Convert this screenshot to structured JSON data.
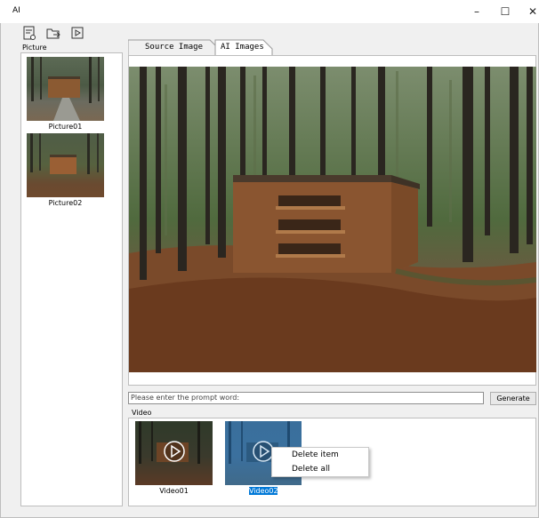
{
  "app": {
    "title": "AI"
  },
  "window_controls": {
    "minimize": "–",
    "maximize": "☐",
    "close": "✕"
  },
  "toolbar": {
    "icons": [
      "document-icon",
      "folder-arrow-icon",
      "play-icon"
    ]
  },
  "sidebar": {
    "title": "Picture",
    "items": [
      {
        "label": "Picture01"
      },
      {
        "label": "Picture02"
      }
    ]
  },
  "tabs": [
    {
      "label": "Source Image"
    },
    {
      "label": "AI Images"
    }
  ],
  "prompt": {
    "placeholder": "Please enter the prompt word:",
    "value": ""
  },
  "generate_button": {
    "label": "Generate"
  },
  "video_section": {
    "title": "Video",
    "items": [
      {
        "label": "Video01"
      },
      {
        "label": "Video02",
        "selected": true
      }
    ]
  },
  "context_menu": {
    "items": [
      {
        "label": "Delete item"
      },
      {
        "label": "Delete all"
      }
    ]
  },
  "colors": {
    "selection": "#0078d7",
    "border": "#bdbdbd",
    "panel_bg": "#ffffff"
  }
}
